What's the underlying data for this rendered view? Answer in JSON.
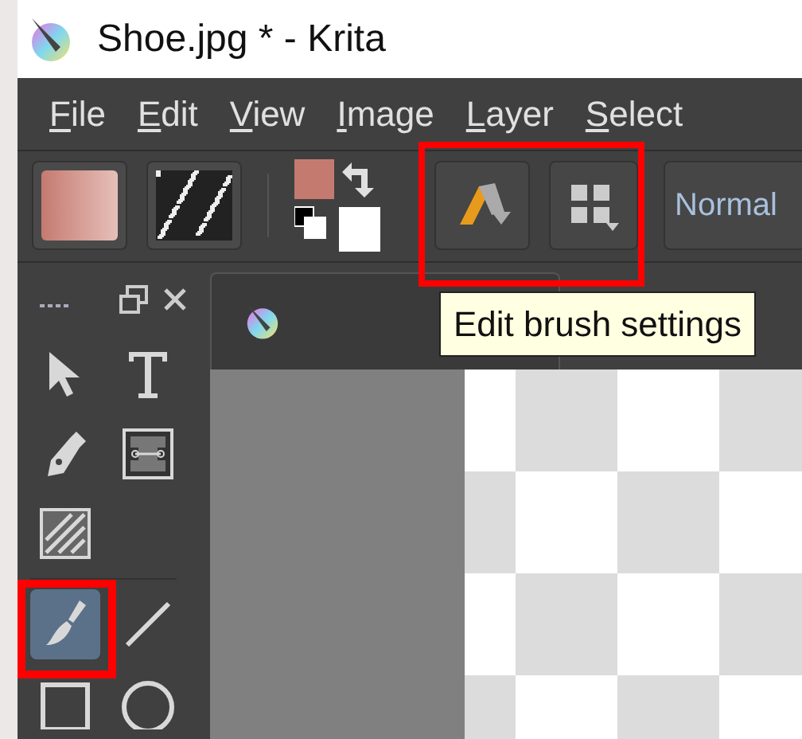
{
  "window": {
    "title": "Shoe.jpg * - Krita"
  },
  "menu": [
    {
      "label": "File"
    },
    {
      "label": "Edit"
    },
    {
      "label": "View"
    },
    {
      "label": "Image"
    },
    {
      "label": "Layer"
    },
    {
      "label": "Select"
    }
  ],
  "toolbar": {
    "blend_mode": "Normal",
    "highlighted": true
  },
  "tooltip": {
    "text": "Edit brush settings"
  },
  "tools": [
    {
      "kind": "select",
      "selected": false,
      "highlighted": false
    },
    {
      "kind": "text",
      "selected": false,
      "highlighted": false
    },
    {
      "kind": "pen",
      "selected": false,
      "highlighted": false
    },
    {
      "kind": "assistant",
      "selected": false,
      "highlighted": false
    },
    {
      "kind": "hatch",
      "selected": false,
      "highlighted": false
    },
    {
      "kind": "brush",
      "selected": true,
      "highlighted": true
    },
    {
      "kind": "line",
      "selected": false,
      "highlighted": false
    },
    {
      "kind": "rect",
      "selected": false,
      "highlighted": false
    },
    {
      "kind": "ellipse",
      "selected": false,
      "highlighted": false
    }
  ]
}
